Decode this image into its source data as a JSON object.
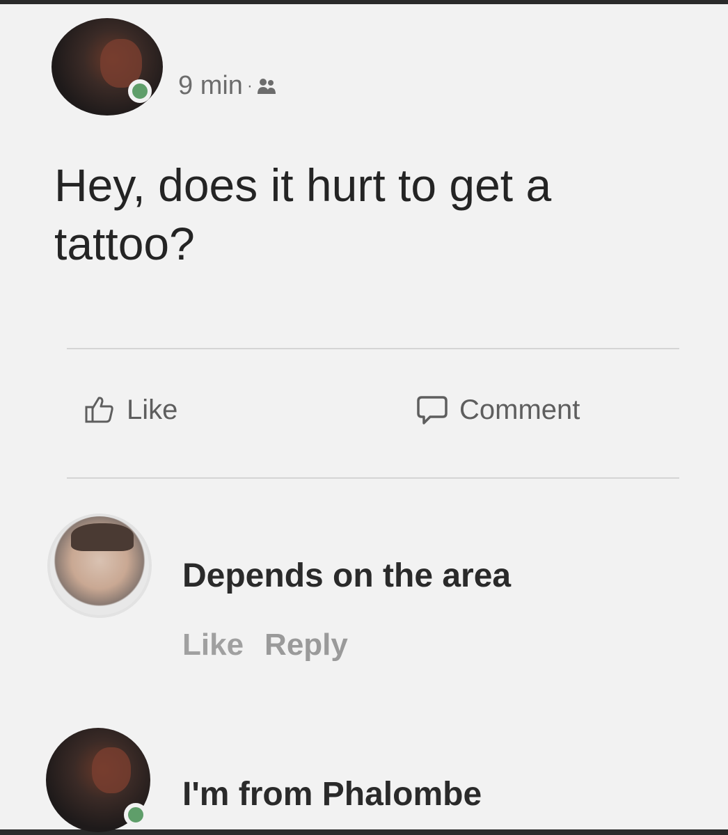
{
  "post": {
    "timestamp": "9 min",
    "separator": "·",
    "audience_icon": "friends-icon",
    "text": "Hey, does it hurt to get a tattoo?"
  },
  "actions": {
    "like_label": "Like",
    "like_icon": "thumbs-up-icon",
    "comment_label": "Comment",
    "comment_icon": "speech-bubble-icon"
  },
  "comments": [
    {
      "text": "Depends on the area",
      "like_label": "Like",
      "reply_label": "Reply"
    },
    {
      "text": "I'm from Phalombe"
    }
  ],
  "colors": {
    "online_status": "#5f9e6a",
    "background": "#f2f2f2",
    "text": "#242424",
    "muted_text": "#6c6c6c"
  }
}
